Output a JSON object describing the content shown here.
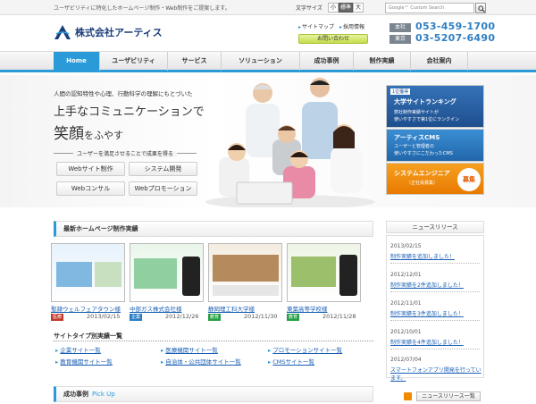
{
  "topbar": {
    "tagline": "ユーザビリティに特化したホームページ制作・Web制作をご提案します。",
    "fontsize_label": "文字サイズ",
    "fontsize_options": [
      "小",
      "標準",
      "大"
    ],
    "search_placeholder": "Google™ Custom Search"
  },
  "header": {
    "company": "株式会社アーティス",
    "links": [
      "サイトマップ",
      "採用情報"
    ],
    "contact": "お問い合わせ",
    "offices": [
      {
        "label": "本社",
        "tel": "053-459-1700"
      },
      {
        "label": "東京",
        "tel": "03-5207-6490"
      }
    ]
  },
  "nav": [
    "Home",
    "ユーザビリティ",
    "サービス",
    "ソリューション",
    "成功事例",
    "制作実績",
    "会社案内"
  ],
  "hero": {
    "sub": "人間の認知特性や心理、行動科学の理解にもとづいた",
    "h1": "上手なコミュニケーションで",
    "h2_main": "笑顔",
    "h2_tail": "をふやす",
    "mini": "ユーザーを満足させることで成果を得る",
    "buttons": [
      "Webサイト制作",
      "システム開発",
      "Webコンサル",
      "Webプロモーション"
    ]
  },
  "ads": {
    "ad1_badge": "1位獲得",
    "ad1_title": "大学サイトランキング",
    "ad1_text": [
      "弊社制作実績サイトが",
      "使いやすさで第1位にランクイン"
    ],
    "ad2_title": "アーティスCMS",
    "ad2_text": [
      "ユーザーと管理者の",
      "使いやすさにこだわったCMS"
    ],
    "ad3_title": "システムエンジニア",
    "ad3_sub": "（正社員募集）",
    "ad3_badge": "募集"
  },
  "works": {
    "title": "最新ホームページ制作実績",
    "items": [
      {
        "name": "聖隷ウェルフェアタウン様",
        "badge": "医療",
        "badge_color": "#c0392b",
        "date": "2013/02/15"
      },
      {
        "name": "中部ガス株式会社様",
        "badge": "企業",
        "badge_color": "#2a7fc4",
        "date": "2012/12/26"
      },
      {
        "name": "静岡理工科大学様",
        "badge": "教育",
        "badge_color": "#27a045",
        "date": "2012/11/30"
      },
      {
        "name": "東葉高等学校様",
        "badge": "教育",
        "badge_color": "#27a045",
        "date": "2012/11/28"
      }
    ]
  },
  "categories": {
    "title": "サイトタイプ別実績一覧",
    "items": [
      "企業サイト一覧",
      "医療機関サイト一覧",
      "プロモーションサイト一覧",
      "教育機関サイト一覧",
      "自治体・公共団体サイト一覧",
      "CMSサイト一覧"
    ]
  },
  "success": {
    "title": "成功事例",
    "pickup": "Pick Up"
  },
  "news": {
    "title": "ニュースリリース",
    "items": [
      {
        "date": "2013/02/15",
        "text": "制作実績を追加しました！"
      },
      {
        "date": "2012/12/01",
        "text": "制作実績を2件追加しました！"
      },
      {
        "date": "2012/11/01",
        "text": "制作実績を3件追加しました！"
      },
      {
        "date": "2012/10/01",
        "text": "制作実績を4件追加しました！"
      },
      {
        "date": "2012/07/04",
        "text": "スマートフォンアプリ開発を行っています。"
      }
    ],
    "more": "ニュースリリース一覧"
  }
}
